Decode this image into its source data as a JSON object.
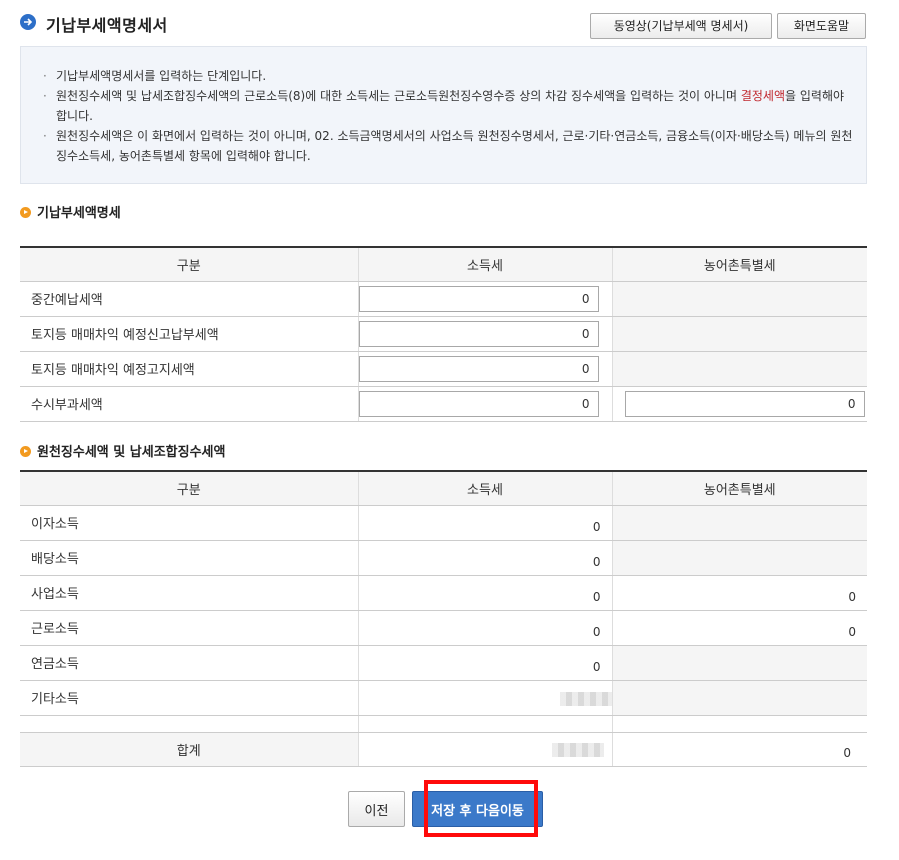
{
  "header": {
    "title": "기납부세액명세서",
    "video_button": "동영상(기납부세액 명세서)",
    "help_button": "화면도움말"
  },
  "info": {
    "line1": "기납부세액명세서를 입력하는 단계입니다.",
    "line2a": "원천징수세액 및 납세조합징수세액의 근로소득(8)에 대한 소득세는 근로소득원천징수영수증 상의 차감 징수세액을 입력하는 것이 아니며 ",
    "line2_red": "결정세액",
    "line2b": "을 입력해야 합니다.",
    "line3": "원천징수세액은 이 화면에서 입력하는 것이 아니며, 02. 소득금액명세서의 사업소득 원천징수명세서, 근로·기타·연금소득, 금융소득(이자·배당소득) 메뉴의 원천징수소득세, 농어촌특별세 항목에 입력해야 합니다."
  },
  "section1": {
    "title": "기납부세액명세",
    "headers": [
      "구분",
      "소득세",
      "농어촌특별세"
    ],
    "rows": [
      {
        "label": "중간예납세액",
        "income_tax": "0"
      },
      {
        "label": "토지등 매매차익 예정신고납부세액",
        "income_tax": "0"
      },
      {
        "label": "토지등 매매차익 예정고지세액",
        "income_tax": "0"
      },
      {
        "label": "수시부과세액",
        "income_tax": "0",
        "rural_tax": "0"
      }
    ]
  },
  "section2": {
    "title": "원천징수세액 및 납세조합징수세액",
    "headers": [
      "구분",
      "소득세",
      "농어촌특별세"
    ],
    "rows": [
      {
        "label": "이자소득",
        "income_tax": "0"
      },
      {
        "label": "배당소득",
        "income_tax": "0"
      },
      {
        "label": "사업소득",
        "income_tax": "0",
        "rural_tax": "0"
      },
      {
        "label": "근로소득",
        "income_tax": "0",
        "rural_tax": "0"
      },
      {
        "label": "연금소득",
        "income_tax": "0"
      },
      {
        "label": "기타소득"
      }
    ],
    "total_label": "합계",
    "total_rural_tax": "0"
  },
  "footer": {
    "prev_button": "이전",
    "next_button": "저장 후 다음이동"
  },
  "colors": {
    "primary": "#3b79c9",
    "highlight": "#ff0a0a",
    "accent_orange": "#f29a1f",
    "info_bg": "#f2f5fa"
  }
}
